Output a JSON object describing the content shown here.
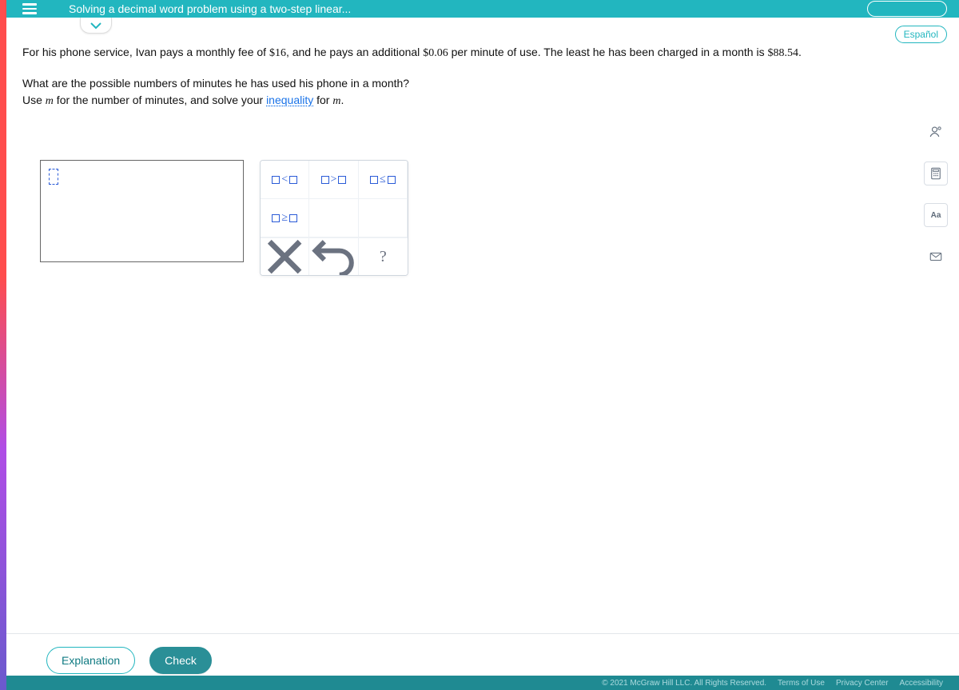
{
  "header": {
    "title": "Solving a decimal word problem using a two-step linear..."
  },
  "lang_button": "Español",
  "problem": {
    "p1_a": "For his phone service, Ivan pays a monthly fee of ",
    "fee": "$16",
    "p1_b": ", and he pays an additional ",
    "rate": "$0.06",
    "p1_c": " per minute of use. The least he has been charged in a month is ",
    "min_charge": "$88.54",
    "p1_d": ".",
    "q1": "What are the possible numbers of minutes he has used his phone in a month?",
    "q2_a": "Use ",
    "var": "m",
    "q2_b": " for the number of minutes, and solve your ",
    "link": "inequality",
    "q2_c": " for ",
    "var2": "m",
    "q2_d": "."
  },
  "keypad": {
    "lt": "<",
    "gt": ">",
    "le": "≤",
    "ge": "≥",
    "clear": "×",
    "undo": "↶",
    "help": "?"
  },
  "buttons": {
    "explanation": "Explanation",
    "check": "Check"
  },
  "footer": {
    "copyright": "© 2021 McGraw Hill LLC. All Rights Reserved.",
    "terms": "Terms of Use",
    "privacy": "Privacy Center",
    "access": "Accessibility"
  },
  "tools": {
    "person": "person-icon",
    "calc": "calculator-icon",
    "aa": "Aa",
    "mail": "mail-icon"
  }
}
